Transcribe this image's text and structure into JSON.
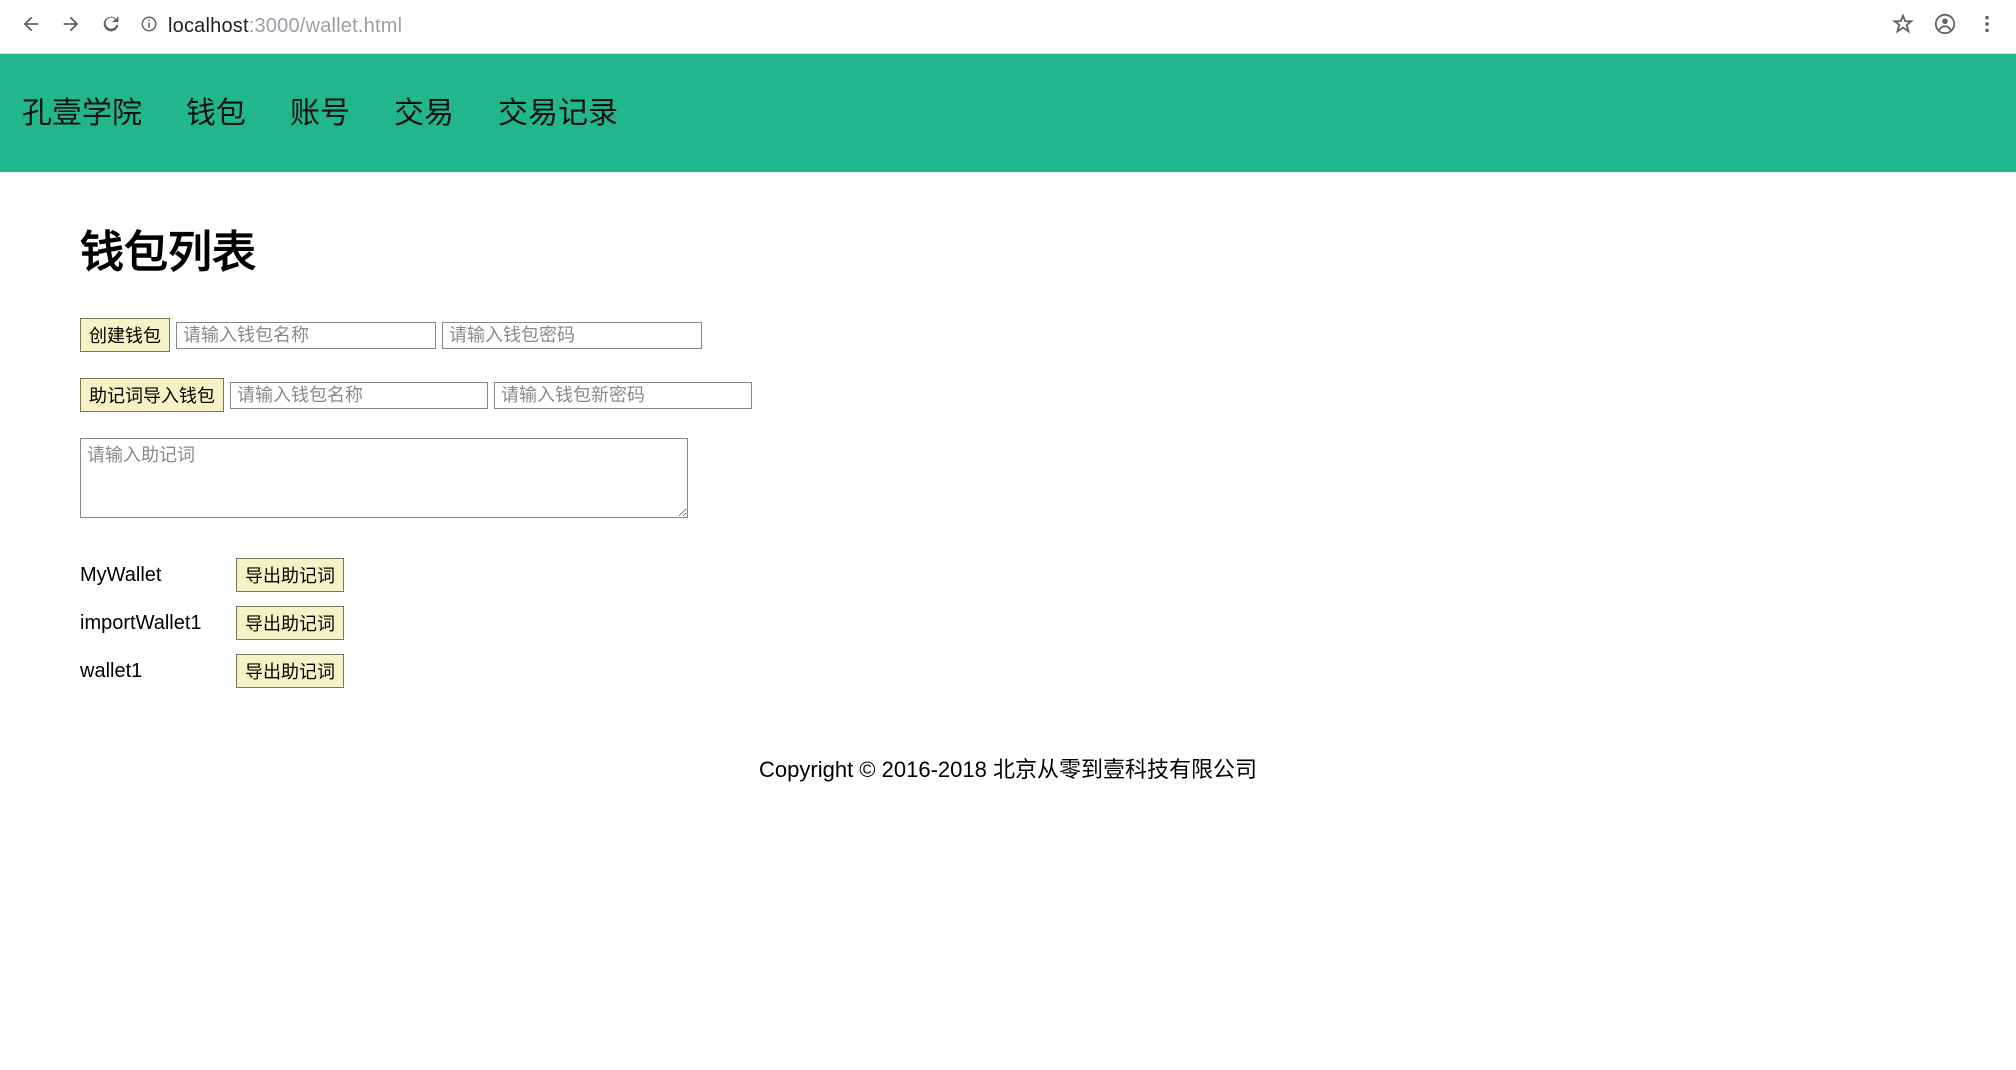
{
  "browser": {
    "url_host": "localhost",
    "url_port_path": ":3000/wallet.html"
  },
  "header": {
    "brand": "孔壹学院",
    "nav": [
      "钱包",
      "账号",
      "交易",
      "交易记录"
    ]
  },
  "main": {
    "title": "钱包列表",
    "create": {
      "button": "创建钱包",
      "name_placeholder": "请输入钱包名称",
      "pass_placeholder": "请输入钱包密码"
    },
    "import": {
      "button": "助记词导入钱包",
      "name_placeholder": "请输入钱包名称",
      "pass_placeholder": "请输入钱包新密码",
      "mnemonic_placeholder": "请输入助记词"
    },
    "wallets": [
      {
        "name": "MyWallet",
        "export_label": "导出助记词"
      },
      {
        "name": "importWallet1",
        "export_label": "导出助记词"
      },
      {
        "name": "wallet1",
        "export_label": "导出助记词"
      }
    ]
  },
  "footer": "Copyright © 2016-2018 北京从零到壹科技有限公司"
}
